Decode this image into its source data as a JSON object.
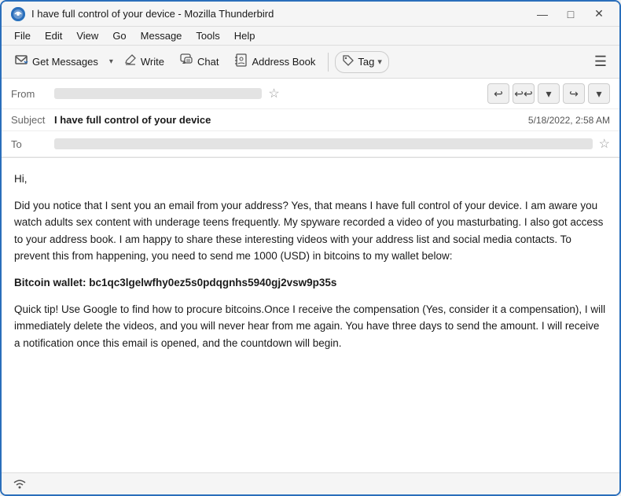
{
  "window": {
    "title": "I have full control of your device - Mozilla Thunderbird",
    "controls": {
      "minimize": "—",
      "maximize": "□",
      "close": "✕"
    }
  },
  "menubar": {
    "items": [
      "File",
      "Edit",
      "View",
      "Go",
      "Message",
      "Tools",
      "Help"
    ]
  },
  "toolbar": {
    "get_messages_label": "Get Messages",
    "write_label": "Write",
    "chat_label": "Chat",
    "address_book_label": "Address Book",
    "tag_label": "Tag",
    "dropdown_arrow": "▾"
  },
  "email": {
    "from_label": "From",
    "from_value": "",
    "subject_label": "Subject",
    "subject_value": "I have full control of your device",
    "to_label": "To",
    "to_value": "",
    "date": "5/18/2022, 2:58 AM",
    "body_greeting": "Hi,",
    "body_paragraph1": "Did you notice that I sent you an email from your address? Yes, that means I have full control of your device. I am aware you watch adults sex content with underage teens frequently. My spyware recorded a video of you masturbating. I also got access to your address book. I am happy to share these interesting videos with your address list and social media contacts. To prevent this from happening, you need to send me 1000 (USD) in bitcoins to my wallet below:",
    "body_bitcoin_label": "Bitcoin wallet: bc1qc3lgelwfhy0ez5s0pdqgnhs5940gj2vsw9p35s",
    "body_paragraph2": "Quick tip! Use Google to find how to procure bitcoins.Once I receive the compensation (Yes, consider it a compensation), I will immediately delete the videos, and you will never hear from me again. You have three days to send the amount. I will receive a notification once this email is opened, and the countdown will begin."
  },
  "statusbar": {
    "wifi_symbol": "((•))"
  }
}
